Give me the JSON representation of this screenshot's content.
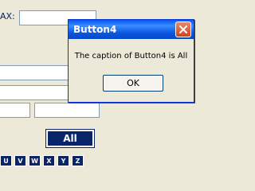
{
  "background": {
    "max_label": "AX:",
    "all_button": "All",
    "keys": [
      "U",
      "V",
      "W",
      "X",
      "Y",
      "Z"
    ]
  },
  "dialog": {
    "title": "Button4",
    "message": "The caption of Button4 is All",
    "ok_label": "OK"
  },
  "colors": {
    "titlebar": "#0a55e0",
    "close_button": "#d2411f",
    "window_bg": "#ece9d8"
  }
}
